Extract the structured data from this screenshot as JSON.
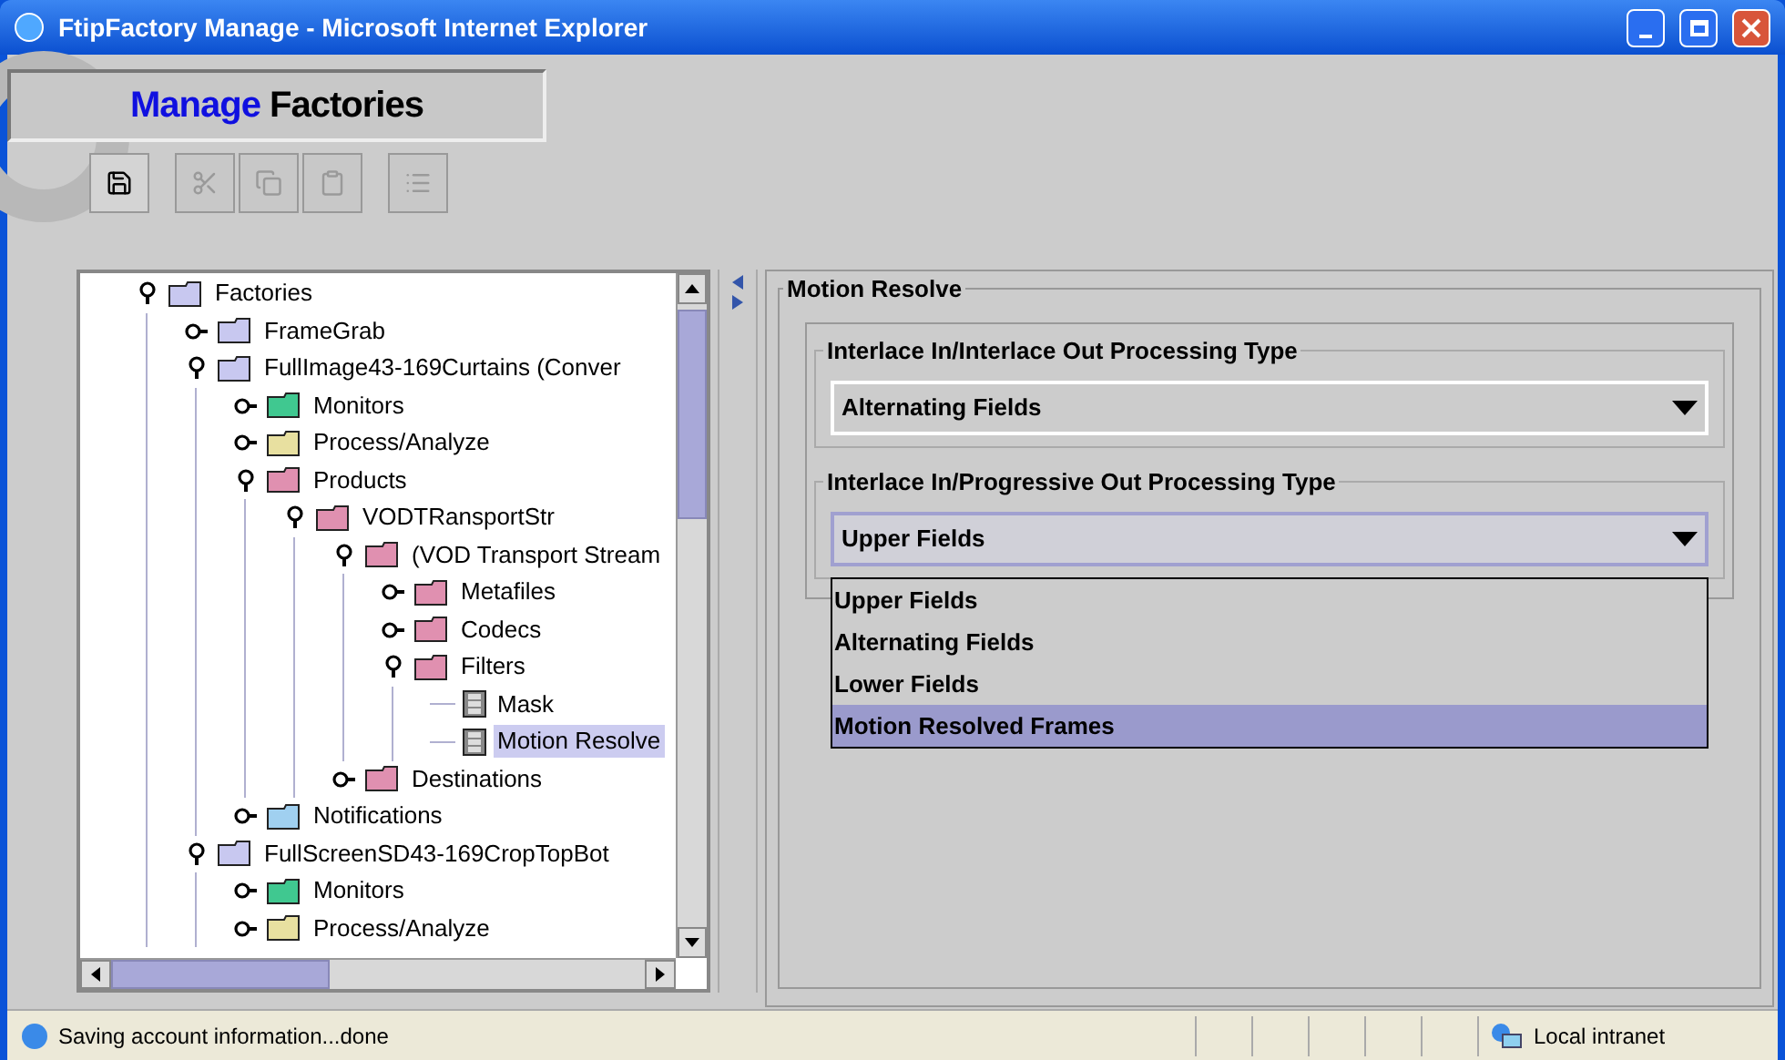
{
  "window": {
    "title": "FtipFactory Manage - Microsoft Internet Explorer"
  },
  "header": {
    "title_part_1": "Manage",
    "title_part_2": "Factories"
  },
  "toolbar": [
    {
      "kind": "save",
      "disabled": false
    },
    {
      "kind": "cut",
      "disabled": true
    },
    {
      "kind": "copy",
      "disabled": true
    },
    {
      "kind": "paste",
      "disabled": true
    },
    {
      "kind": "list",
      "disabled": true
    }
  ],
  "tree": [
    {
      "label": "Factories",
      "kind": "folder",
      "color": "#c8c8f0",
      "expanded": true,
      "selected": false,
      "children": [
        {
          "label": "FrameGrab",
          "kind": "folder",
          "color": "#c8c8f0",
          "expanded": false,
          "selected": false
        },
        {
          "label": "FullImage43-169Curtains (Conver",
          "kind": "folder",
          "color": "#c8c8f0",
          "expanded": true,
          "selected": false,
          "children": [
            {
              "label": "Monitors",
              "kind": "folder",
              "color": "#40c890",
              "expanded": false,
              "selected": false
            },
            {
              "label": "Process/Analyze",
              "kind": "folder",
              "color": "#e8e0a0",
              "expanded": false,
              "selected": false
            },
            {
              "label": "Products",
              "kind": "folder",
              "color": "#e090b0",
              "expanded": true,
              "selected": false,
              "children": [
                {
                  "label": "VODTRansportStr",
                  "kind": "folder",
                  "color": "#e090b0",
                  "expanded": true,
                  "selected": false,
                  "children": [
                    {
                      "label": "(VOD Transport Stream",
                      "kind": "folder",
                      "color": "#e090b0",
                      "expanded": true,
                      "selected": false,
                      "children": [
                        {
                          "label": "Metafiles",
                          "kind": "folder",
                          "color": "#e090b0",
                          "expanded": false,
                          "selected": false
                        },
                        {
                          "label": "Codecs",
                          "kind": "folder",
                          "color": "#e090b0",
                          "expanded": false,
                          "selected": false
                        },
                        {
                          "label": "Filters",
                          "kind": "folder",
                          "color": "#e090b0",
                          "expanded": true,
                          "selected": false,
                          "children": [
                            {
                              "label": "Mask",
                              "kind": "filter",
                              "selected": false
                            },
                            {
                              "label": "Motion Resolve",
                              "kind": "filter",
                              "selected": true
                            }
                          ]
                        }
                      ]
                    },
                    {
                      "label": "Destinations",
                      "kind": "folder",
                      "color": "#e090b0",
                      "expanded": false,
                      "selected": false
                    }
                  ]
                }
              ]
            },
            {
              "label": "Notifications",
              "kind": "folder",
              "color": "#a0d0f0",
              "expanded": false,
              "selected": false
            }
          ]
        },
        {
          "label": "FullScreenSD43-169CropTopBot",
          "kind": "folder",
          "color": "#c8c8f0",
          "expanded": true,
          "selected": false,
          "children": [
            {
              "label": "Monitors",
              "kind": "folder",
              "color": "#40c890",
              "expanded": false,
              "selected": false
            },
            {
              "label": "Process/Analyze",
              "kind": "folder",
              "color": "#e8e0a0",
              "expanded": false,
              "selected": false
            }
          ]
        }
      ]
    }
  ],
  "panel": {
    "title": "Motion Resolve",
    "groups": [
      {
        "label": "Interlace In/Interlace Out Processing Type",
        "value": "Alternating Fields",
        "open": false
      },
      {
        "label": "Interlace In/Progressive Out Processing Type",
        "value": "Upper Fields",
        "open": true,
        "options": [
          {
            "label": "Upper Fields",
            "highlighted": false
          },
          {
            "label": "Alternating Fields",
            "highlighted": false
          },
          {
            "label": "Lower Fields",
            "highlighted": false
          },
          {
            "label": "Motion Resolved Frames",
            "highlighted": true
          }
        ]
      }
    ]
  },
  "status_bar": {
    "text": "Saving account information...done",
    "zone": "Local intranet"
  }
}
